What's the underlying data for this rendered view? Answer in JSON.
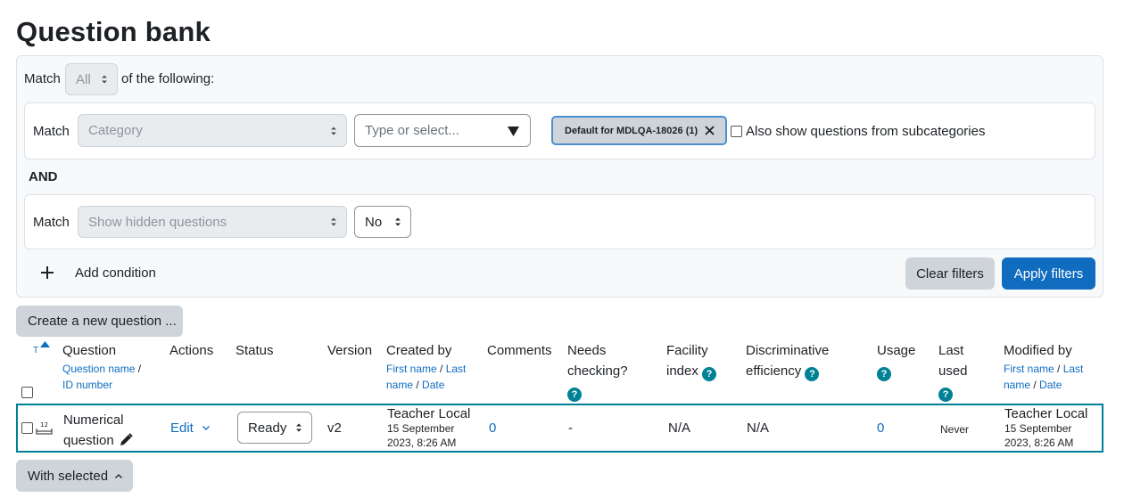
{
  "page": {
    "title": "Question bank"
  },
  "filters": {
    "match_label": "Match",
    "match_value": "All",
    "of_following": "of the following:",
    "condition1": {
      "match_label": "Match",
      "type_value": "Category",
      "search_placeholder": "Type or select...",
      "tag_label": "Default for MDLQA-18026 (1)",
      "subcat_label": "Also show questions from subcategories"
    },
    "and_label": "AND",
    "condition2": {
      "match_label": "Match",
      "type_value": "Show hidden questions",
      "value": "No"
    },
    "add_condition": "Add condition",
    "clear": "Clear filters",
    "apply": "Apply filters"
  },
  "create_button": "Create a new question ...",
  "table": {
    "sort_t": "T",
    "headers": {
      "question": "Question",
      "question_sub1": "Question name",
      "question_sep": " / ",
      "question_sub2": "ID number",
      "actions": "Actions",
      "status": "Status",
      "version": "Version",
      "created_by": "Created by",
      "created_sub1": "First name",
      "created_sep1": " / ",
      "created_sub2": "Last",
      "created_sub3": "name",
      "created_sep2": " / ",
      "created_sub4": "Date",
      "comments": "Comments",
      "needs_checking_1": "Needs",
      "needs_checking_2": "checking?",
      "facility_1": "Facility",
      "facility_2": "index",
      "discrim_1": "Discriminative",
      "discrim_2": "efficiency",
      "usage": "Usage",
      "last_used_1": "Last",
      "last_used_2": "used",
      "modified_by": "Modified by",
      "modified_sub1": "First name",
      "modified_sep1": " / ",
      "modified_sub2": "Last",
      "modified_sub3": "name",
      "modified_sep2": " / ",
      "modified_sub4": "Date"
    },
    "row": {
      "question_line1": "Numerical",
      "question_line2": "question",
      "qtype_badge": "12",
      "edit": "Edit",
      "status": "Ready",
      "version": "v2",
      "created_name": "Teacher Local",
      "created_date1": "15 September",
      "created_date2": "2023, 8:26 AM",
      "comments": "0",
      "needs_checking": "-",
      "facility": "N/A",
      "discrim": "N/A",
      "usage": "0",
      "last_used": "Never",
      "modified_name": "Teacher Local",
      "modified_date1": "15 September",
      "modified_date2": "2023, 8:26 AM"
    }
  },
  "with_selected": "With selected",
  "help_glyph": "?",
  "colors": {
    "primary": "#0f6cbf",
    "teal": "#008196",
    "secondary": "#ced4da"
  }
}
